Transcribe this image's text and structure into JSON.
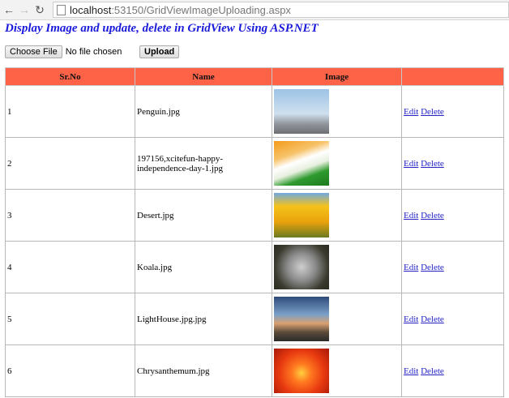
{
  "browser": {
    "url_host": "localhost",
    "url_rest": ":53150/GridViewImageUploading.aspx"
  },
  "title": "Display Image and update, delete in GridView Using ASP.NET",
  "upload": {
    "choose_label": "Choose File",
    "status": "No file chosen",
    "upload_label": "Upload"
  },
  "table": {
    "headers": [
      "Sr.No",
      "Name",
      "Image",
      ""
    ],
    "rows": [
      {
        "no": "1",
        "name": "Penguin.jpg",
        "image": "penguins",
        "edit": "Edit",
        "delete": "Delete"
      },
      {
        "no": "2",
        "name": "197156,xcitefun-happy-independence-day-1.jpg",
        "image": "india-flag",
        "edit": "Edit",
        "delete": "Delete"
      },
      {
        "no": "3",
        "name": "Desert.jpg",
        "image": "tulips",
        "edit": "Edit",
        "delete": "Delete"
      },
      {
        "no": "4",
        "name": "Koala.jpg",
        "image": "koala",
        "edit": "Edit",
        "delete": "Delete"
      },
      {
        "no": "5",
        "name": "LightHouse.jpg.jpg",
        "image": "lighthouse",
        "edit": "Edit",
        "delete": "Delete"
      },
      {
        "no": "6",
        "name": "Chrysanthemum.jpg",
        "image": "chrysanthemum",
        "edit": "Edit",
        "delete": "Delete"
      }
    ]
  },
  "colors": {
    "header": "#ff6347",
    "title": "#1a1adb",
    "link": "#2323c8"
  }
}
